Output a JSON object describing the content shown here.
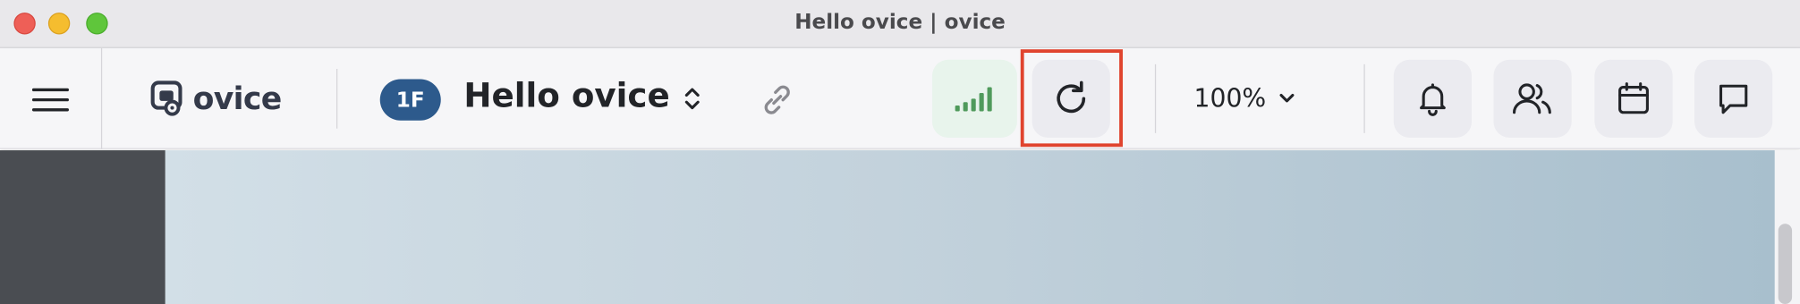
{
  "window": {
    "title": "Hello ovice | ovice"
  },
  "toolbar": {
    "logo_text": "ovice",
    "floor_badge": "1F",
    "space_name": "Hello ovice",
    "zoom_label": "100%"
  },
  "icons": {
    "menu": "hamburger-menu-icon",
    "logo": "ovice-logo-icon",
    "switch": "chevron-up-down-icon",
    "link": "link-icon",
    "signal": "signal-strength-icon",
    "refresh": "refresh-icon",
    "zoom_dropdown": "chevron-down-icon",
    "notifications": "bell-icon",
    "members": "users-icon",
    "calendar": "calendar-icon",
    "chat": "chat-bubble-icon"
  },
  "colors": {
    "accent_badge": "#2d5a8c",
    "signal_green": "#4f9a5b",
    "highlight": "#e0442e"
  }
}
